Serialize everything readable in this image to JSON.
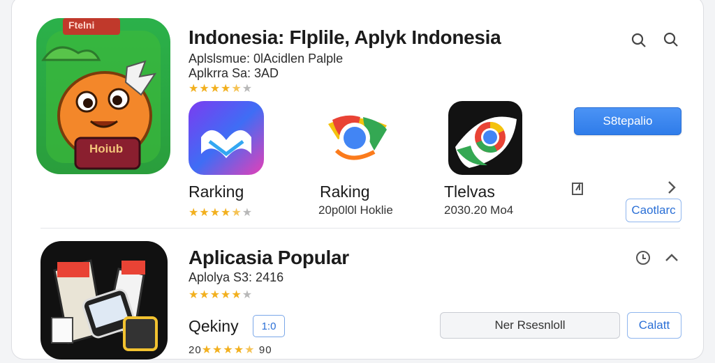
{
  "featured": {
    "icon_label": "Hoiub",
    "icon_top_label": "Ftelni",
    "title": "Indonesia: Flplile, Aplyk Indonesia",
    "subtitle": "Aplslsmue: 0lAcidlen Palple",
    "size_line": "Aplkrra Sa: 3AD",
    "rating_stars": 4.5
  },
  "header_icons": [
    "search-alt-icon",
    "search-icon"
  ],
  "apps": [
    {
      "name": "Rarking",
      "meta": "",
      "rating_stars": 4.5,
      "icon": "gradient-ribbon-app-icon"
    },
    {
      "name": "Raking",
      "meta": "20p0l0l Hoklie",
      "icon": "chrome-like-app-icon"
    },
    {
      "name": "Tlelvas",
      "meta": "2030.20 Mo4",
      "icon": "eye-chrome-app-icon"
    }
  ],
  "buttons": {
    "primary": "S8tepalio",
    "outline_top": "Caotlarc",
    "gray": "Ner Rsesnloll",
    "outline_bottom": "Calatt"
  },
  "popular": {
    "title": "Aplicasia Popular",
    "size_line": "Aplolya S3: 2416",
    "rating_stars": 4.5,
    "item_name": "Qekiny",
    "item_badge": "1:0",
    "item_meta": "20",
    "item_meta2": "90"
  },
  "colors": {
    "accent": "#2f7ce9",
    "star": "#f2b01e"
  }
}
